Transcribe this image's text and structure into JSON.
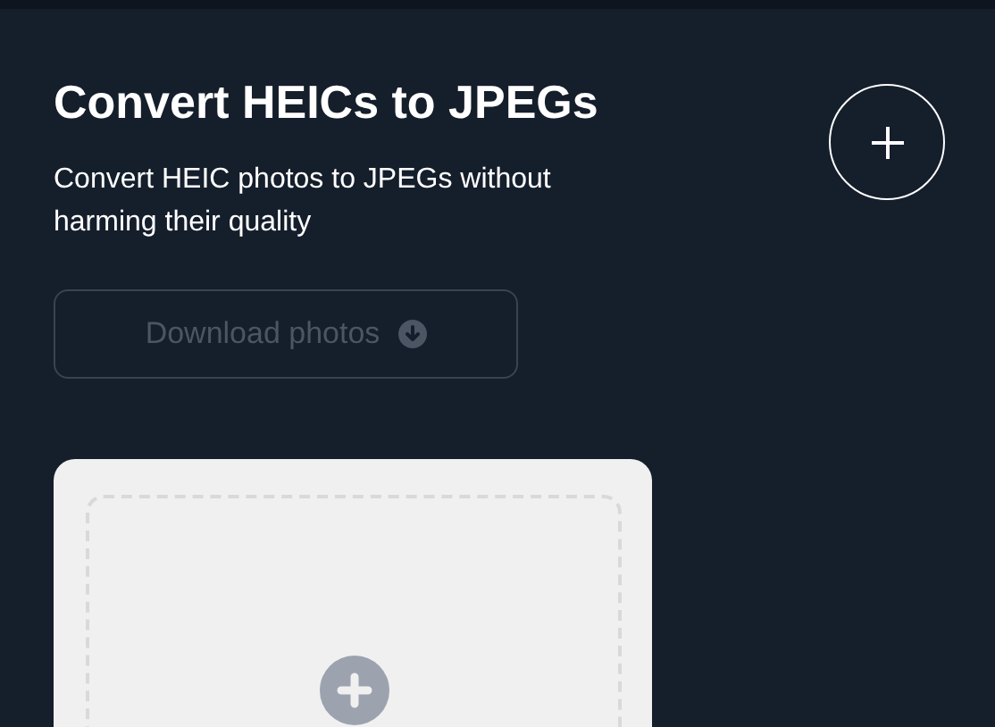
{
  "header": {
    "title": "Convert HEICs to JPEGs",
    "subtitle": "Convert HEIC photos to JPEGs without harming their quality"
  },
  "download_button": {
    "label": "Download photos",
    "disabled": true
  }
}
